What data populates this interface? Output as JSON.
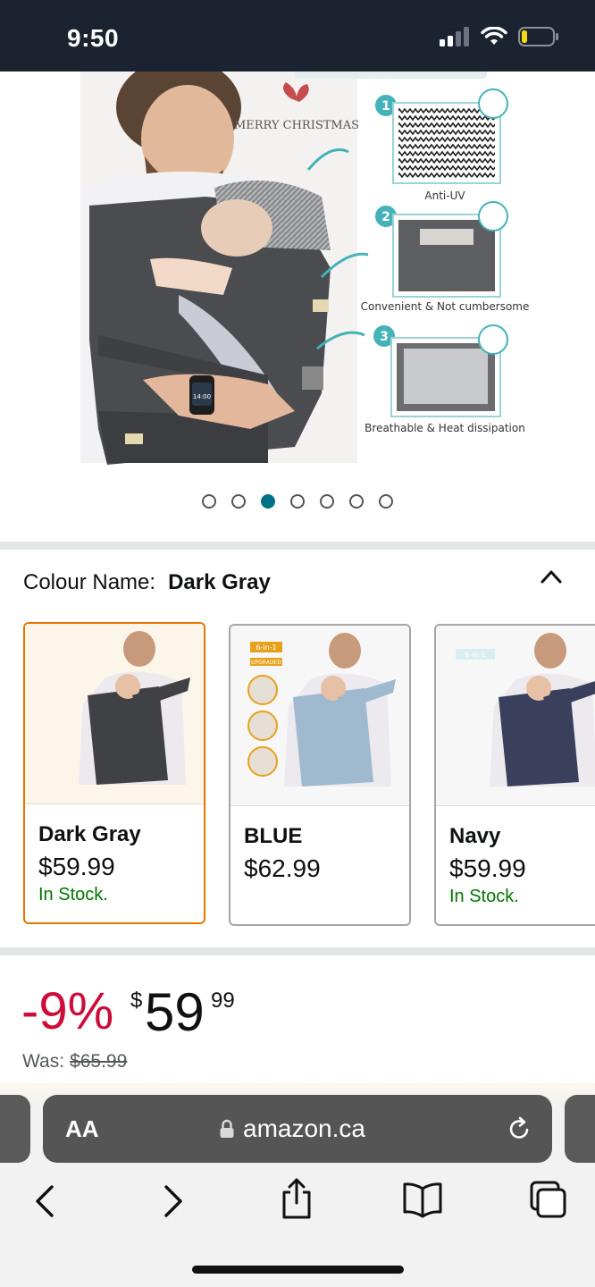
{
  "status_bar": {
    "time": "9:50"
  },
  "product_image": {
    "annotation_top": "MERRY CHRISTMAS",
    "features": [
      {
        "number": "1",
        "label": "Anti-UV"
      },
      {
        "number": "2",
        "label": "Convenient & Not cumbersome"
      },
      {
        "number": "3",
        "label": "Breathable & Heat dissipation"
      }
    ],
    "watch_time": "14:00",
    "carousel": {
      "count": 7,
      "active_index": 2
    }
  },
  "colour": {
    "label": "Colour Name:",
    "selected": "Dark Gray",
    "options": [
      {
        "name": "Dark Gray",
        "price": "$59.99",
        "stock": "In Stock.",
        "color": "#3f4144",
        "badge": ""
      },
      {
        "name": "BLUE",
        "price": "$62.99",
        "stock": "",
        "color": "#9fb9cf",
        "badge": "6-in-1"
      },
      {
        "name": "Navy",
        "price": "$59.99",
        "stock": "In Stock.",
        "color": "#3a3f5c",
        "badge": "6-in-1"
      }
    ],
    "badge_sub": "UPGRADED"
  },
  "price": {
    "discount": "-9%",
    "symbol": "$",
    "whole": "59",
    "fraction": "99",
    "was_label": "Was:",
    "was_value": "$65.99"
  },
  "browser": {
    "aa_label": "AA",
    "domain": "amazon.ca"
  },
  "colors": {
    "accent": "#007185",
    "selected_border": "#e77600",
    "discount": "#cc0c39",
    "in_stock": "#007600"
  }
}
